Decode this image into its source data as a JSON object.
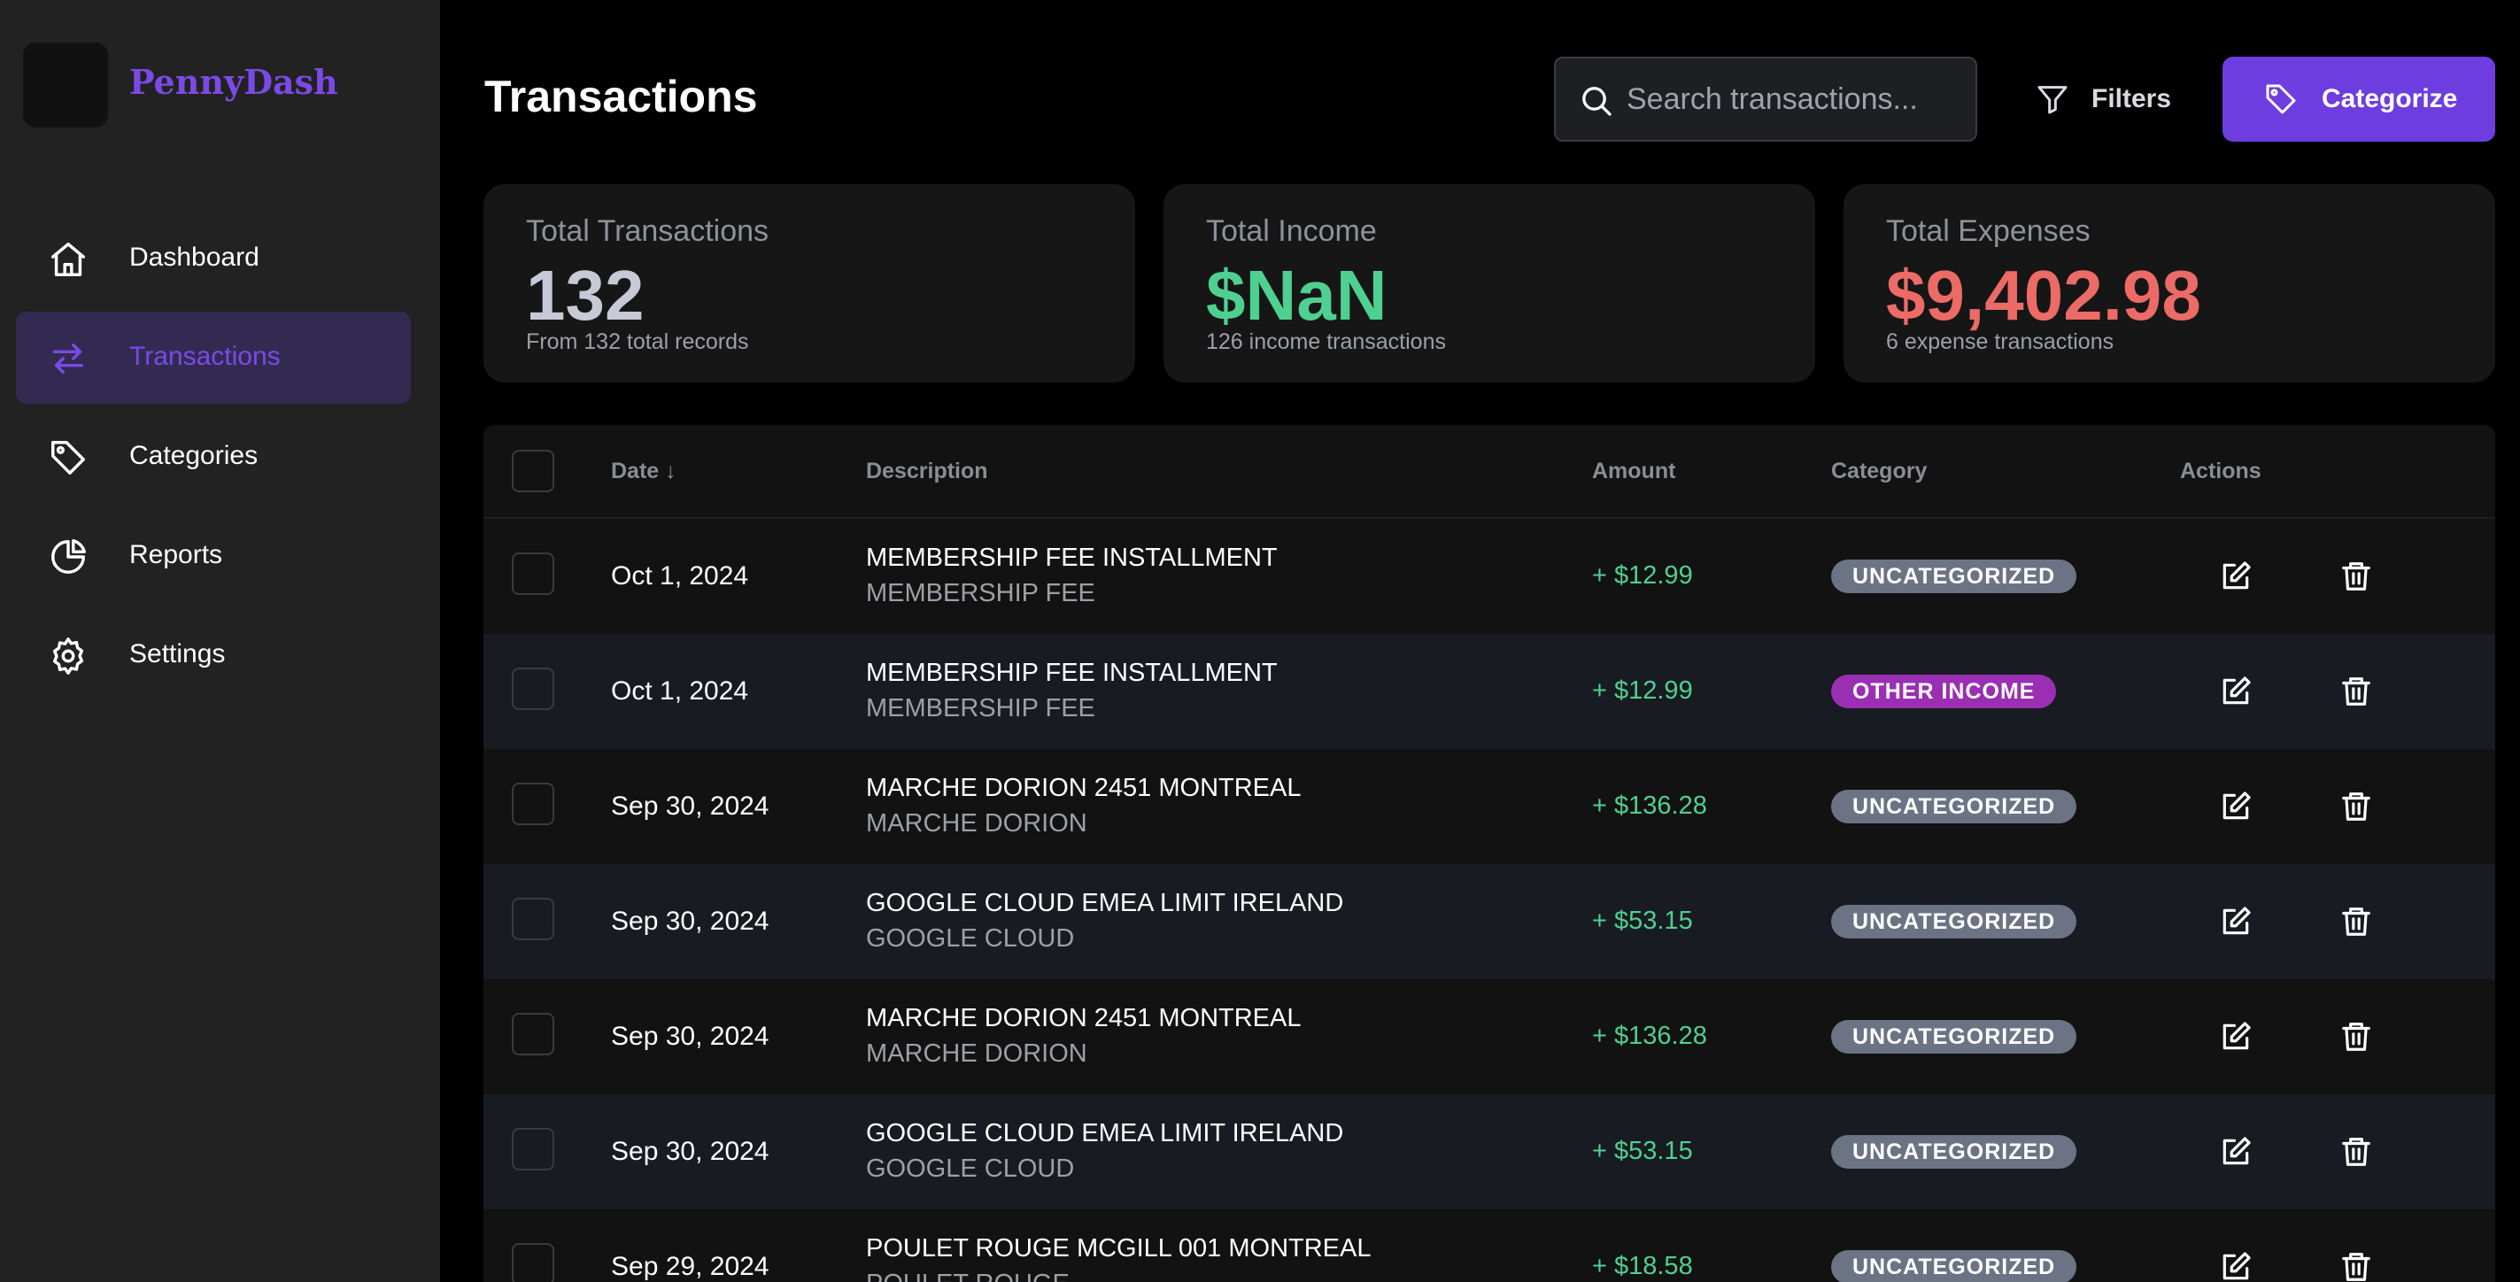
{
  "app": {
    "name": "PennyDash",
    "brand_color": "#7b4ae6",
    "accent_color": "#6d3de0"
  },
  "sidebar": {
    "items": [
      {
        "label": "Dashboard",
        "icon": "home-icon",
        "active": false
      },
      {
        "label": "Transactions",
        "icon": "transfer-arrows-icon",
        "active": true
      },
      {
        "label": "Categories",
        "icon": "tag-icon",
        "active": false
      },
      {
        "label": "Reports",
        "icon": "pie-chart-icon",
        "active": false
      },
      {
        "label": "Settings",
        "icon": "gear-icon",
        "active": false
      }
    ]
  },
  "header": {
    "title": "Transactions",
    "search": {
      "placeholder": "Search transactions...",
      "value": ""
    },
    "filters_label": "Filters",
    "categorize_label": "Categorize"
  },
  "stats": [
    {
      "label": "Total Transactions",
      "value": "132",
      "sub": "From 132 total records",
      "color": "#c7cad6"
    },
    {
      "label": "Total Income",
      "value": "$NaN",
      "sub": "126 income transactions",
      "color": "#4ed090"
    },
    {
      "label": "Total Expenses",
      "value": "$9,402.98",
      "sub": "6 expense transactions",
      "color": "#ec6b66"
    }
  ],
  "table": {
    "columns": {
      "date": "Date ↓",
      "description": "Description",
      "amount": "Amount",
      "category": "Category",
      "actions": "Actions"
    },
    "rows": [
      {
        "date": "Oct 1, 2024",
        "description": "MEMBERSHIP FEE INSTALLMENT",
        "merchant": "MEMBERSHIP FEE",
        "amount": "+ $12.99",
        "category": "UNCATEGORIZED",
        "category_color": "#6b7384"
      },
      {
        "date": "Oct 1, 2024",
        "description": "MEMBERSHIP FEE INSTALLMENT",
        "merchant": "MEMBERSHIP FEE",
        "amount": "+ $12.99",
        "category": "OTHER INCOME",
        "category_color": "#9a2fb3"
      },
      {
        "date": "Sep 30, 2024",
        "description": "MARCHE DORION 2451 MONTREAL",
        "merchant": "MARCHE DORION",
        "amount": "+ $136.28",
        "category": "UNCATEGORIZED",
        "category_color": "#6b7384"
      },
      {
        "date": "Sep 30, 2024",
        "description": "GOOGLE CLOUD EMEA LIMIT IRELAND",
        "merchant": "GOOGLE CLOUD",
        "amount": "+ $53.15",
        "category": "UNCATEGORIZED",
        "category_color": "#6b7384"
      },
      {
        "date": "Sep 30, 2024",
        "description": "MARCHE DORION 2451 MONTREAL",
        "merchant": "MARCHE DORION",
        "amount": "+ $136.28",
        "category": "UNCATEGORIZED",
        "category_color": "#6b7384"
      },
      {
        "date": "Sep 30, 2024",
        "description": "GOOGLE CLOUD EMEA LIMIT IRELAND",
        "merchant": "GOOGLE CLOUD",
        "amount": "+ $53.15",
        "category": "UNCATEGORIZED",
        "category_color": "#6b7384"
      },
      {
        "date": "Sep 29, 2024",
        "description": "POULET ROUGE MCGILL 001 MONTREAL",
        "merchant": "POULET ROUGE",
        "amount": "+ $18.58",
        "category": "UNCATEGORIZED",
        "category_color": "#6b7384"
      }
    ]
  }
}
